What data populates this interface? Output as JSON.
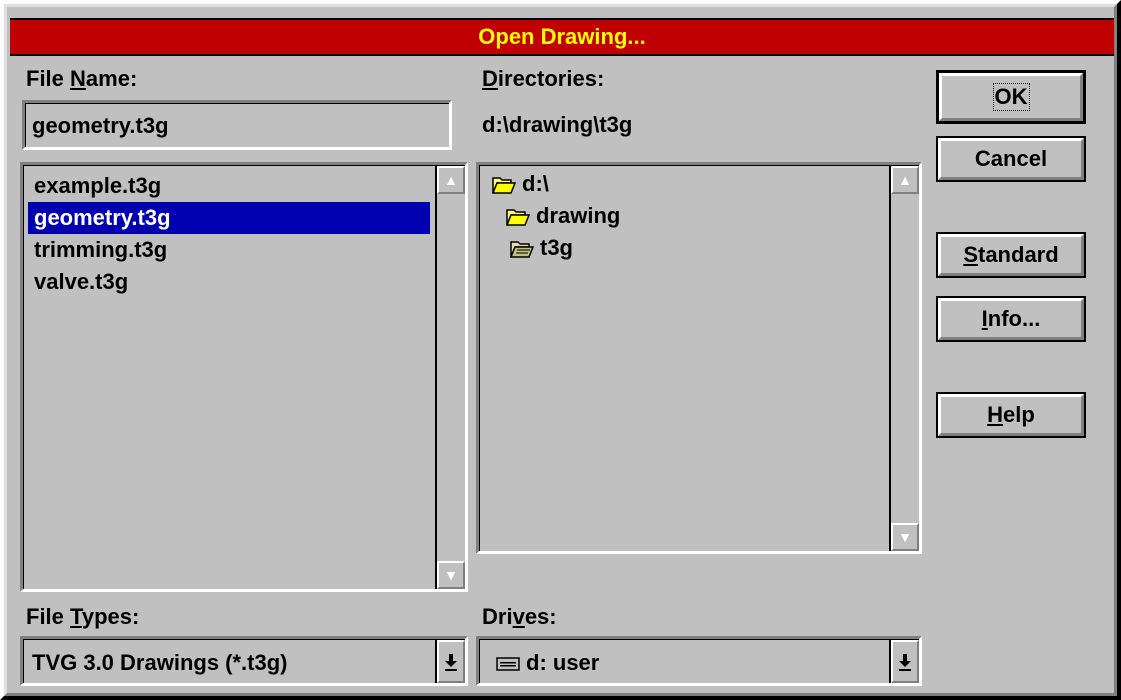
{
  "dialog": {
    "title": "Open Drawing..."
  },
  "file_name": {
    "label_pre": "File ",
    "label_u": "N",
    "label_post": "ame:",
    "value": "geometry.t3g"
  },
  "file_list": {
    "items": [
      {
        "label": "example.t3g",
        "selected": false
      },
      {
        "label": "geometry.t3g",
        "selected": true
      },
      {
        "label": "trimming.t3g",
        "selected": false
      },
      {
        "label": "valve.t3g",
        "selected": false
      }
    ]
  },
  "directories": {
    "label_u": "D",
    "label_post": "irectories:",
    "current_path": "d:\\drawing\\t3g",
    "items": [
      {
        "label": "d:\\",
        "icon": "open-folder-icon"
      },
      {
        "label": "drawing",
        "icon": "open-folder-icon"
      },
      {
        "label": "t3g",
        "icon": "open-folder-current-icon"
      }
    ]
  },
  "buttons": {
    "ok": "OK",
    "cancel": "Cancel",
    "standard_u": "S",
    "standard_post": "tandard",
    "info_u": "I",
    "info_post": "nfo...",
    "help_u": "H",
    "help_post": "elp"
  },
  "file_types": {
    "label_pre": "File ",
    "label_u": "T",
    "label_post": "ypes:",
    "value": "TVG 3.0 Drawings (*.t3g)"
  },
  "drives": {
    "label_pre": "Dri",
    "label_u": "v",
    "label_post": "es:",
    "value": "d: user",
    "icon": "drive-icon"
  },
  "colors": {
    "title_bg": "#c00000",
    "title_text": "#ffff00",
    "selection_bg": "#0000b0",
    "face": "#c0c0c0"
  }
}
